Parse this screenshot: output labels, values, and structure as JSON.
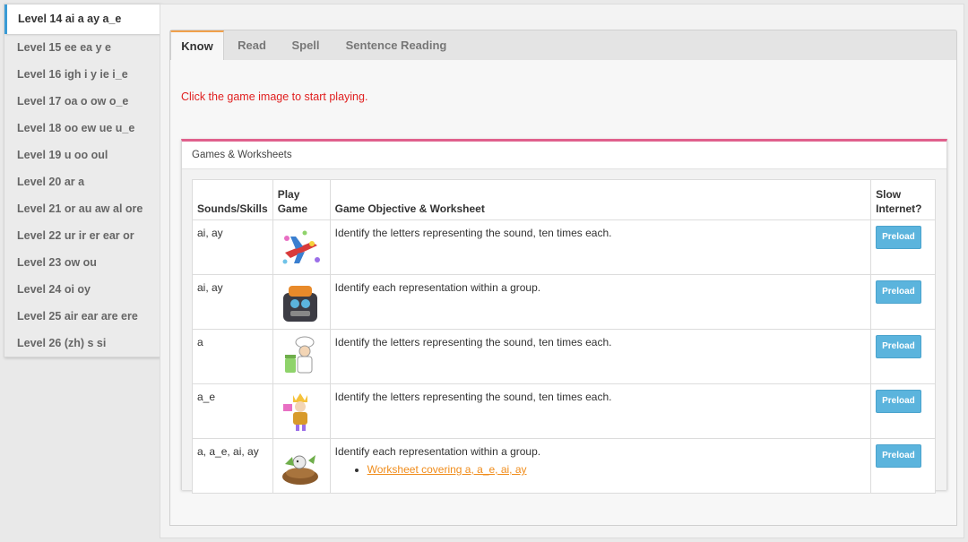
{
  "sidebar": {
    "items": [
      {
        "label": "Level 14 ai a ay a_e",
        "active": true
      },
      {
        "label": "Level 15 ee ea y e"
      },
      {
        "label": "Level 16 igh i y ie i_e"
      },
      {
        "label": "Level 17 oa o ow o_e"
      },
      {
        "label": "Level 18 oo ew ue u_e"
      },
      {
        "label": "Level 19 u oo oul"
      },
      {
        "label": "Level 20 ar a"
      },
      {
        "label": "Level 21 or au aw al ore"
      },
      {
        "label": "Level 22 ur ir er ear or"
      },
      {
        "label": "Level 23 ow ou"
      },
      {
        "label": "Level 24 oi oy"
      },
      {
        "label": "Level 25 air ear are ere"
      },
      {
        "label": "Level 26 (zh) s si"
      }
    ]
  },
  "tabs": [
    {
      "label": "Know",
      "active": true
    },
    {
      "label": "Read"
    },
    {
      "label": "Spell"
    },
    {
      "label": "Sentence Reading"
    }
  ],
  "instruction": "Click the game image to start playing.",
  "games": {
    "panel_title": "Games & Worksheets",
    "columns": [
      "Sounds/Skills",
      "Play Game",
      "Game Objective & Worksheet",
      "Slow Internet?"
    ],
    "rows": [
      {
        "sounds": "ai, ay",
        "icon": "airplane-game-icon",
        "objective": "Identify the letters representing the sound, ten times each.",
        "button": "Preload"
      },
      {
        "sounds": "ai, ay",
        "icon": "robot-machine-game-icon",
        "objective": "Identify each representation within a group.",
        "button": "Preload"
      },
      {
        "sounds": "a",
        "icon": "chef-game-icon",
        "objective": "Identify the letters representing the sound, ten times each.",
        "button": "Preload"
      },
      {
        "sounds": "a_e",
        "icon": "king-game-icon",
        "objective": "Identify the letters representing the sound, ten times each.",
        "button": "Preload"
      },
      {
        "sounds": "a, a_e, ai, ay",
        "icon": "bird-nest-game-icon",
        "objective": "Identify each representation within a group.",
        "worksheet": "Worksheet covering a, a_e, ai, ay",
        "button": "Preload"
      }
    ]
  },
  "colors": {
    "active_tab_accent": "#f0a04b",
    "panel_accent": "#e0608c",
    "instruction": "#e02020",
    "preload_button": "#5bb4dd",
    "worksheet_link": "#f08c1a",
    "sidebar_active_accent": "#3a9bd5"
  }
}
